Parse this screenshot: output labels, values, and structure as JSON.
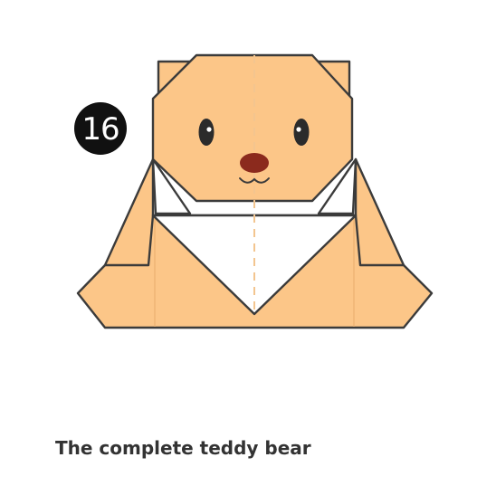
{
  "step": {
    "number": "16"
  },
  "caption": {
    "text": "The complete teddy bear"
  },
  "colors": {
    "paper": "#fcc688",
    "paper_reverse": "#ffffff",
    "outline": "#3b3b3b",
    "crease": "#f2a65e",
    "nose": "#8b2a1d",
    "badge": "#111111"
  }
}
